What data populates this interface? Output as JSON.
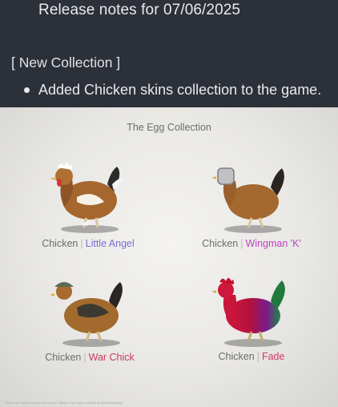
{
  "release_notes": {
    "title": "Release notes for 07/06/2025",
    "section": "[ New Collection ]",
    "items": [
      "Added Chicken skins collection to the game."
    ]
  },
  "collection": {
    "title": "The Egg Collection",
    "separator": "|",
    "skins": [
      {
        "base": "Chicken",
        "name": "Little Angel",
        "name_color": "#7a6cd8"
      },
      {
        "base": "Chicken",
        "name": "Wingman 'K'",
        "name_color": "#c03fc0"
      },
      {
        "base": "Chicken",
        "name": "War Chick",
        "name_color": "#c73a5c"
      },
      {
        "base": "Chicken",
        "name": "Fade",
        "name_color": "#d03a6c"
      }
    ],
    "footnote": "This is fan-made concept. Not real or official. Fan-made concept by @thelonelyegg"
  },
  "icons": [
    "chicken-little-angel-icon",
    "chicken-wingman-k-icon",
    "chicken-war-chick-icon",
    "chicken-fade-icon"
  ]
}
